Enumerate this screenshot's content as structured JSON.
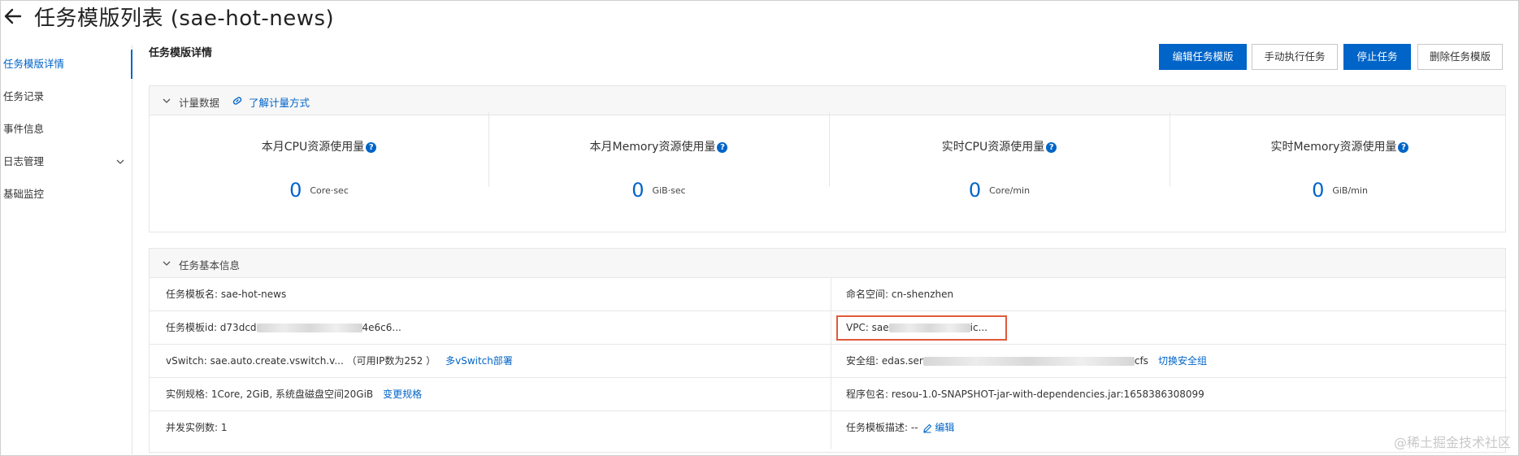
{
  "header": {
    "title": "任务模版列表 (sae-hot-news)"
  },
  "sidebar": {
    "items": [
      {
        "label": "任务模版详情"
      },
      {
        "label": "任务记录"
      },
      {
        "label": "事件信息"
      },
      {
        "label": "日志管理"
      },
      {
        "label": "基础监控"
      }
    ]
  },
  "main": {
    "section_title": "任务模版详情",
    "buttons": {
      "edit": "编辑任务模版",
      "run": "手动执行任务",
      "stop": "停止任务",
      "delete": "删除任务模版"
    },
    "metering": {
      "title": "计量数据",
      "link": "了解计量方式",
      "metrics": [
        {
          "label": "本月CPU资源使用量",
          "value": "0",
          "unit": "Core·sec"
        },
        {
          "label": "本月Memory资源使用量",
          "value": "0",
          "unit": "GiB·sec"
        },
        {
          "label": "实时CPU资源使用量",
          "value": "0",
          "unit": "Core/min"
        },
        {
          "label": "实时Memory资源使用量",
          "value": "0",
          "unit": "GiB/min"
        }
      ]
    },
    "basic_info": {
      "title": "任务基本信息",
      "name": "任务模板名: sae-hot-news",
      "namespace": "命名空间: cn-shenzhen",
      "id_prefix": "任务模板id: d73dcd",
      "id_suffix": "4e6c6...",
      "vpc_prefix": "VPC: sae",
      "vpc_suffix": "ic...",
      "vswitch": "vSwitch: sae.auto.create.vswitch.v... （可用IP数为252 ）",
      "vswitch_link": "多vSwitch部署",
      "security_prefix": "安全组: edas.ser",
      "security_suffix": "cfs",
      "security_link": "切换安全组",
      "spec": "实例规格: 1Core, 2GiB, 系统盘磁盘空间20GiB",
      "spec_link": "变更规格",
      "package": "程序包名: resou-1.0-SNAPSHOT-jar-with-dependencies.jar:1658386308099",
      "concurrency": "并发实例数: 1",
      "desc": "任务模板描述: --",
      "desc_link": "编辑"
    }
  },
  "watermark": "@稀土掘金技术社区",
  "colors": {
    "accent": "#0064c8",
    "highlight": "#e05a3a"
  }
}
